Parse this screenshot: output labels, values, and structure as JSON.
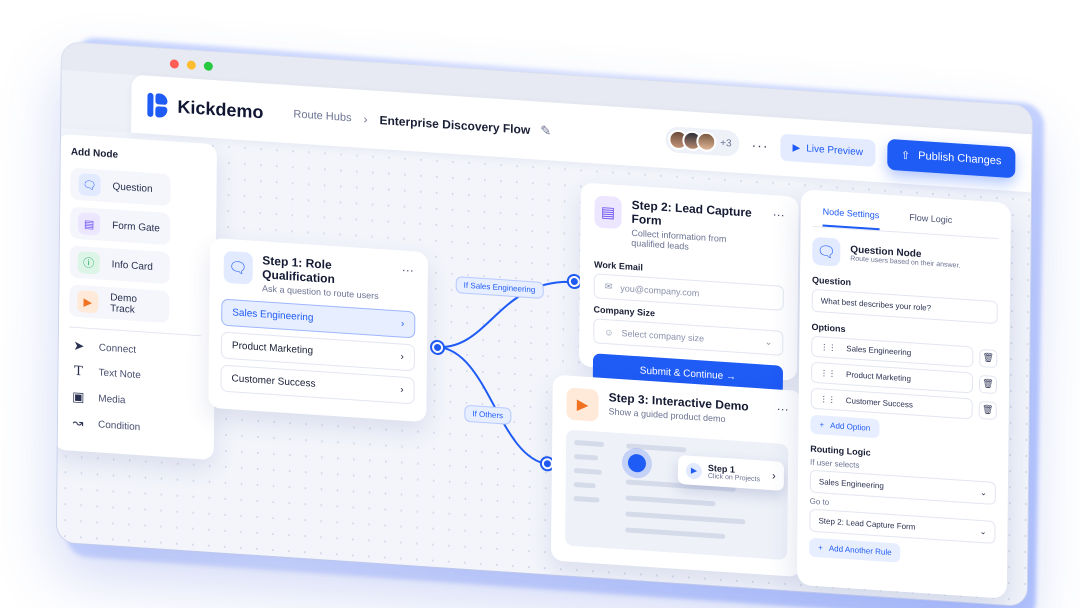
{
  "app": {
    "name": "Kickdemo"
  },
  "header": {
    "breadcrumb_root": "Route Hubs",
    "breadcrumb_sep": "›",
    "flow_title": "Enterprise Discovery Flow",
    "collaborators_more": "+3",
    "live_preview": "Live Preview",
    "publish": "Publish Changes"
  },
  "palette": {
    "title": "Add Node",
    "nodes": [
      {
        "label": "Question",
        "icon": "chat-bubble-icon"
      },
      {
        "label": "Form Gate",
        "icon": "form-document-icon"
      },
      {
        "label": "Info Card",
        "icon": "info-icon"
      },
      {
        "label": "Demo Track",
        "icon": "play-icon"
      }
    ],
    "tools": [
      {
        "label": "Connect",
        "icon": "cursor-arrow-icon"
      },
      {
        "label": "Text Note",
        "icon": "text-icon"
      },
      {
        "label": "Media",
        "icon": "image-icon"
      },
      {
        "label": "Condition",
        "icon": "branch-icon"
      }
    ]
  },
  "step1": {
    "title": "Step 1: Role Qualification",
    "subtitle": "Ask a question to route users",
    "options": [
      "Sales Engineering",
      "Product Marketing",
      "Customer Success"
    ]
  },
  "edges": {
    "if_sales": "If Sales Engineering",
    "if_others": "If Others"
  },
  "step2": {
    "title": "Step 2: Lead Capture Form",
    "subtitle": "Collect information from qualified leads",
    "email_label": "Work Email",
    "email_placeholder": "you@company.com",
    "size_label": "Company Size",
    "size_placeholder": "Select company size",
    "submit": "Submit & Continue"
  },
  "step3": {
    "title": "Step 3: Interactive Demo",
    "subtitle": "Show a guided product demo",
    "tooltip_title": "Step 1",
    "tooltip_sub": "Click on Projects"
  },
  "settings": {
    "tab_node": "Node Settings",
    "tab_flow": "Flow Logic",
    "node_title": "Question Node",
    "node_sub": "Route users based on their answer.",
    "question_label": "Question",
    "question_value": "What best describes your role?",
    "options_label": "Options",
    "options": [
      "Sales Engineering",
      "Product Marketing",
      "Customer Success"
    ],
    "add_option": "Add Option",
    "routing_label": "Routing Logic",
    "if_user_selects": "If user selects",
    "selected_value": "Sales Engineering",
    "go_to": "Go to",
    "go_to_value": "Step 2: Lead Capture Form",
    "add_rule": "Add Another Rule"
  },
  "colors": {
    "accent": "#1f5bf5",
    "background": "#f3f5fb"
  }
}
